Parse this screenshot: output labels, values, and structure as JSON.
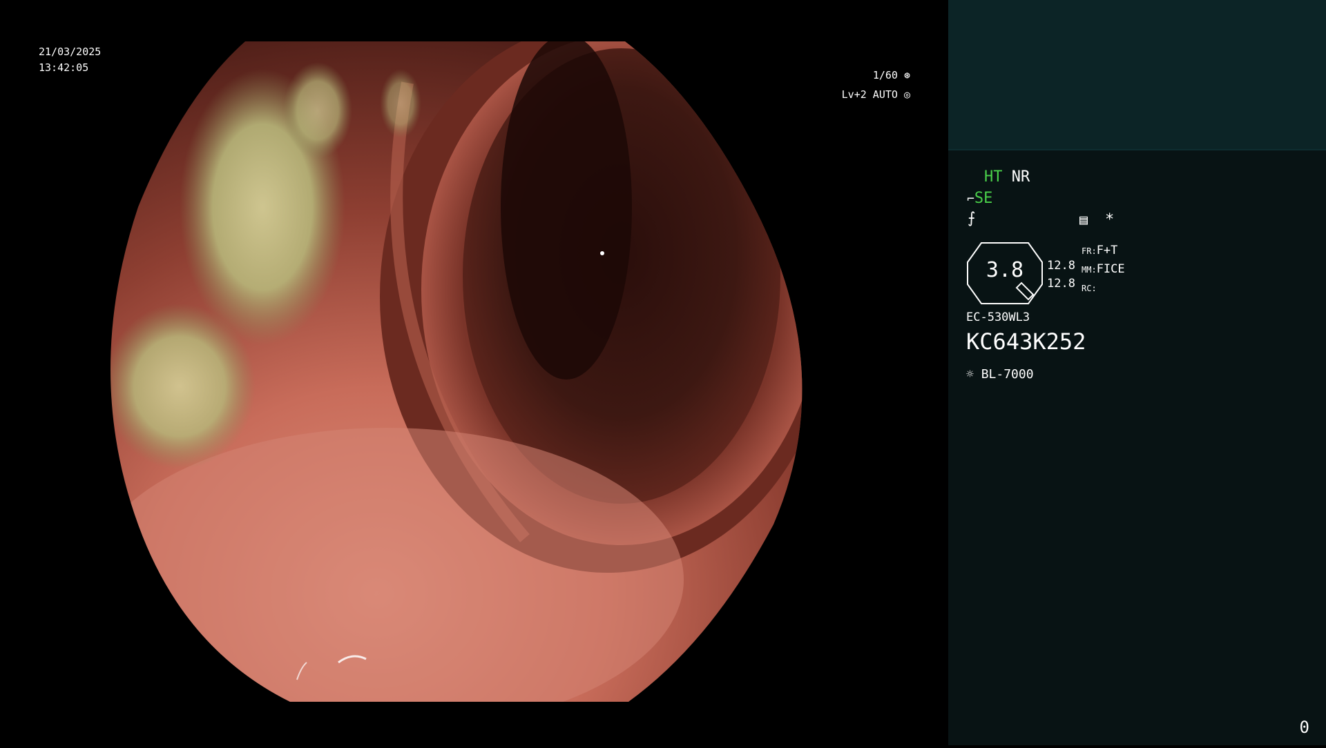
{
  "timestamp": {
    "date": "21/03/2025",
    "time": "13:42:05"
  },
  "top_right": {
    "shutter": "1/60",
    "exposure": "Lv+2 AUTO",
    "shutter_icon": "aperture-icon",
    "auto_icon": "iris-icon"
  },
  "panel": {
    "ht_label": "HT",
    "nr_label": "NR",
    "se_label": "SE",
    "se_icon": "scope-icon",
    "f_icon": "f-curve-icon",
    "settings_icon": "menu-list-icon",
    "asterisk": "*",
    "zoom_value": "3.8",
    "val1": "12.8",
    "val2": "12.8",
    "fr_label": "FR:",
    "fr_value": "F+T",
    "mm_label": "MM:",
    "mm_value": "FICE",
    "rc_label": "RC:",
    "scope_model": "EC-530WL3",
    "serial": "KC643K252",
    "light_icon": "light-source-icon",
    "light_source": "BL-7000",
    "counter": "0"
  },
  "colors": {
    "panel_bg": "#081314",
    "thumb_bg": "#0c2426",
    "accent_green": "#4ad04a",
    "mucosa_dark": "#3a1a16",
    "mucosa_light": "#c8705f"
  }
}
